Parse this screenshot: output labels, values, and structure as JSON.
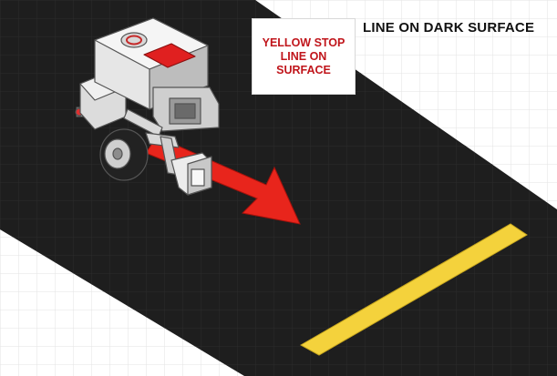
{
  "callout": {
    "text": "YELLOW STOP\nLINE ON\nSURFACE",
    "text_color": "#c0151b"
  },
  "heading": {
    "text": "LINE ON DARK SURFACE"
  },
  "colors": {
    "surface": "#1e1e1e",
    "stop_line": "#f4d23c",
    "arrow": "#e8251c",
    "robot_body": "#e6e6e6",
    "robot_screen": "#e02020"
  },
  "icons": {
    "robot": "lego-ev3-robot-icon",
    "direction": "direction-arrow-icon"
  }
}
